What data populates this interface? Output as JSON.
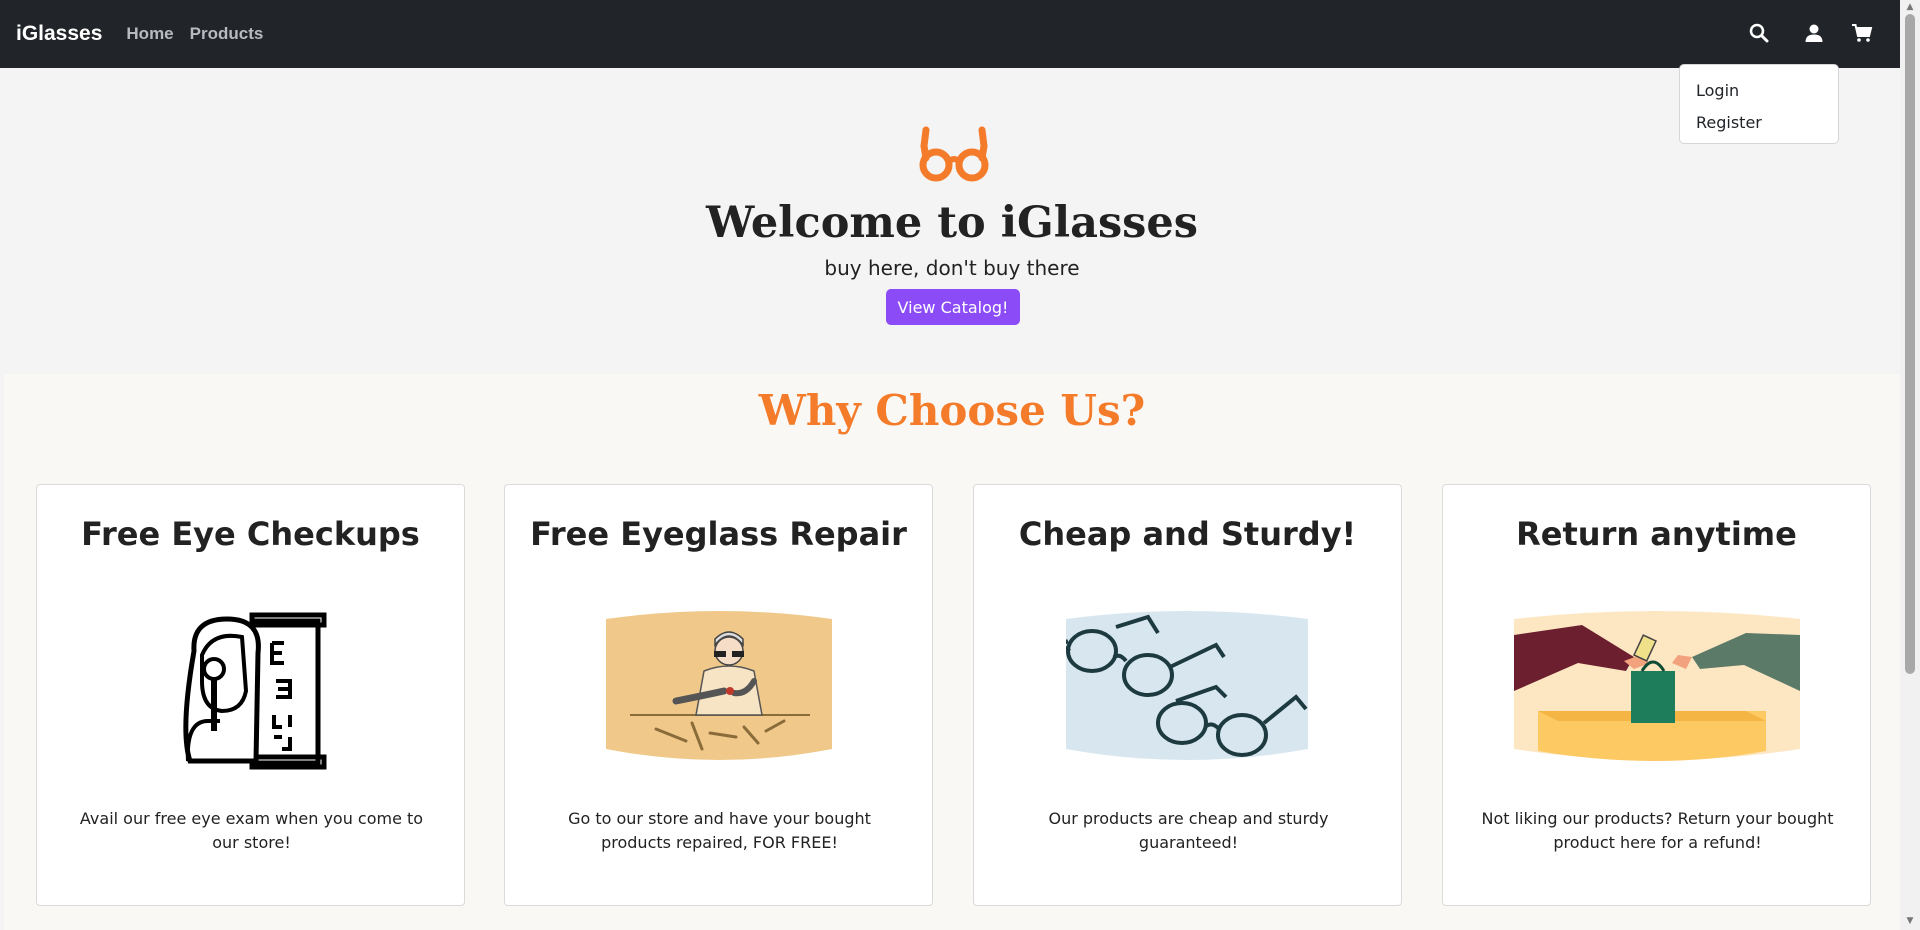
{
  "navbar": {
    "brand": "iGlasses",
    "links": [
      "Home",
      "Products"
    ],
    "icons": [
      "search-icon",
      "user-icon",
      "cart-icon"
    ]
  },
  "dropdown": {
    "items": [
      "Login",
      "Register"
    ]
  },
  "hero": {
    "icon": "glasses-icon",
    "title": "Welcome to iGlasses",
    "subtitle": "buy here, don't buy there",
    "button_label": "View Catalog!"
  },
  "why": {
    "title": "Why Choose Us?",
    "cards": [
      {
        "title": "Free Eye Checkups",
        "image": "eye-exam-illustration",
        "text": "Avail our free eye exam when you come to our store!"
      },
      {
        "title": "Free Eyeglass Repair",
        "image": "repair-illustration",
        "text": "Go to our store and have your bought products repaired, FOR FREE!"
      },
      {
        "title": "Cheap and Sturdy!",
        "image": "glasses-illustration",
        "text": "Our products are cheap and sturdy guaranteed!"
      },
      {
        "title": "Return anytime",
        "image": "return-illustration",
        "text": "Not liking our products? Return your bought product here for a refund!"
      }
    ]
  },
  "colors": {
    "navbar_bg": "#212529",
    "accent_orange": "#f47b2a",
    "button_purple": "#8b4cf8"
  }
}
